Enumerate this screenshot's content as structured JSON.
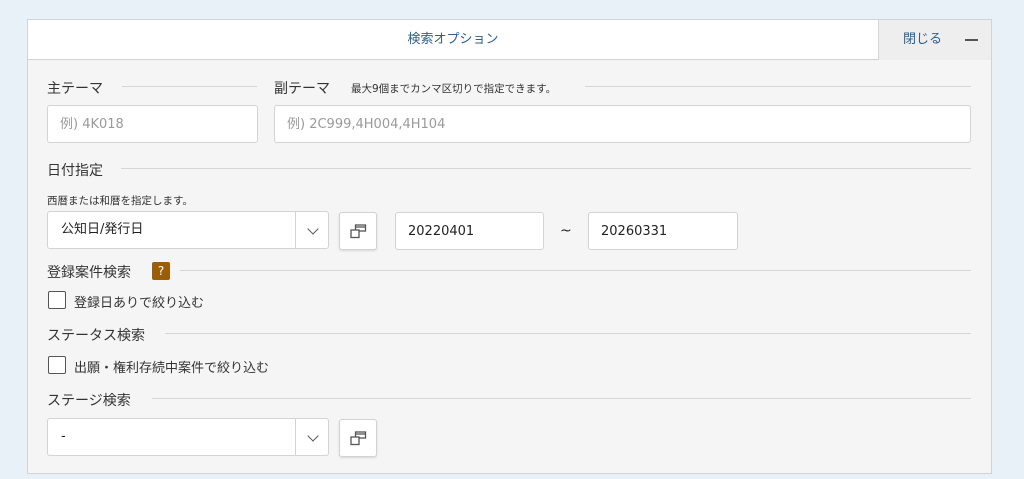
{
  "header": {
    "title": "検索オプション",
    "close_label": "閉じる"
  },
  "main_theme": {
    "label": "主テーマ",
    "placeholder": "例) 4K018"
  },
  "sub_theme": {
    "label": "副テーマ",
    "note": "最大9個までカンマ区切りで指定できます。",
    "placeholder": "例) 2C999,4H004,4H104"
  },
  "date": {
    "label": "日付指定",
    "note": "西暦または和暦を指定します。",
    "type_value": "公知日/発行日",
    "from": "20220401",
    "separator": "~",
    "to": "20260331"
  },
  "registered": {
    "label": "登録案件検索",
    "help": "?",
    "checkbox_label": "登録日ありで絞り込む"
  },
  "status": {
    "label": "ステータス検索",
    "checkbox_label": "出願・権利存続中案件で絞り込む"
  },
  "stage": {
    "label": "ステージ検索",
    "value": "-"
  },
  "colors": {
    "accent_text": "#2e5e8a",
    "help_badge": "#9b5d08",
    "page_background": "#e9f1f8"
  }
}
